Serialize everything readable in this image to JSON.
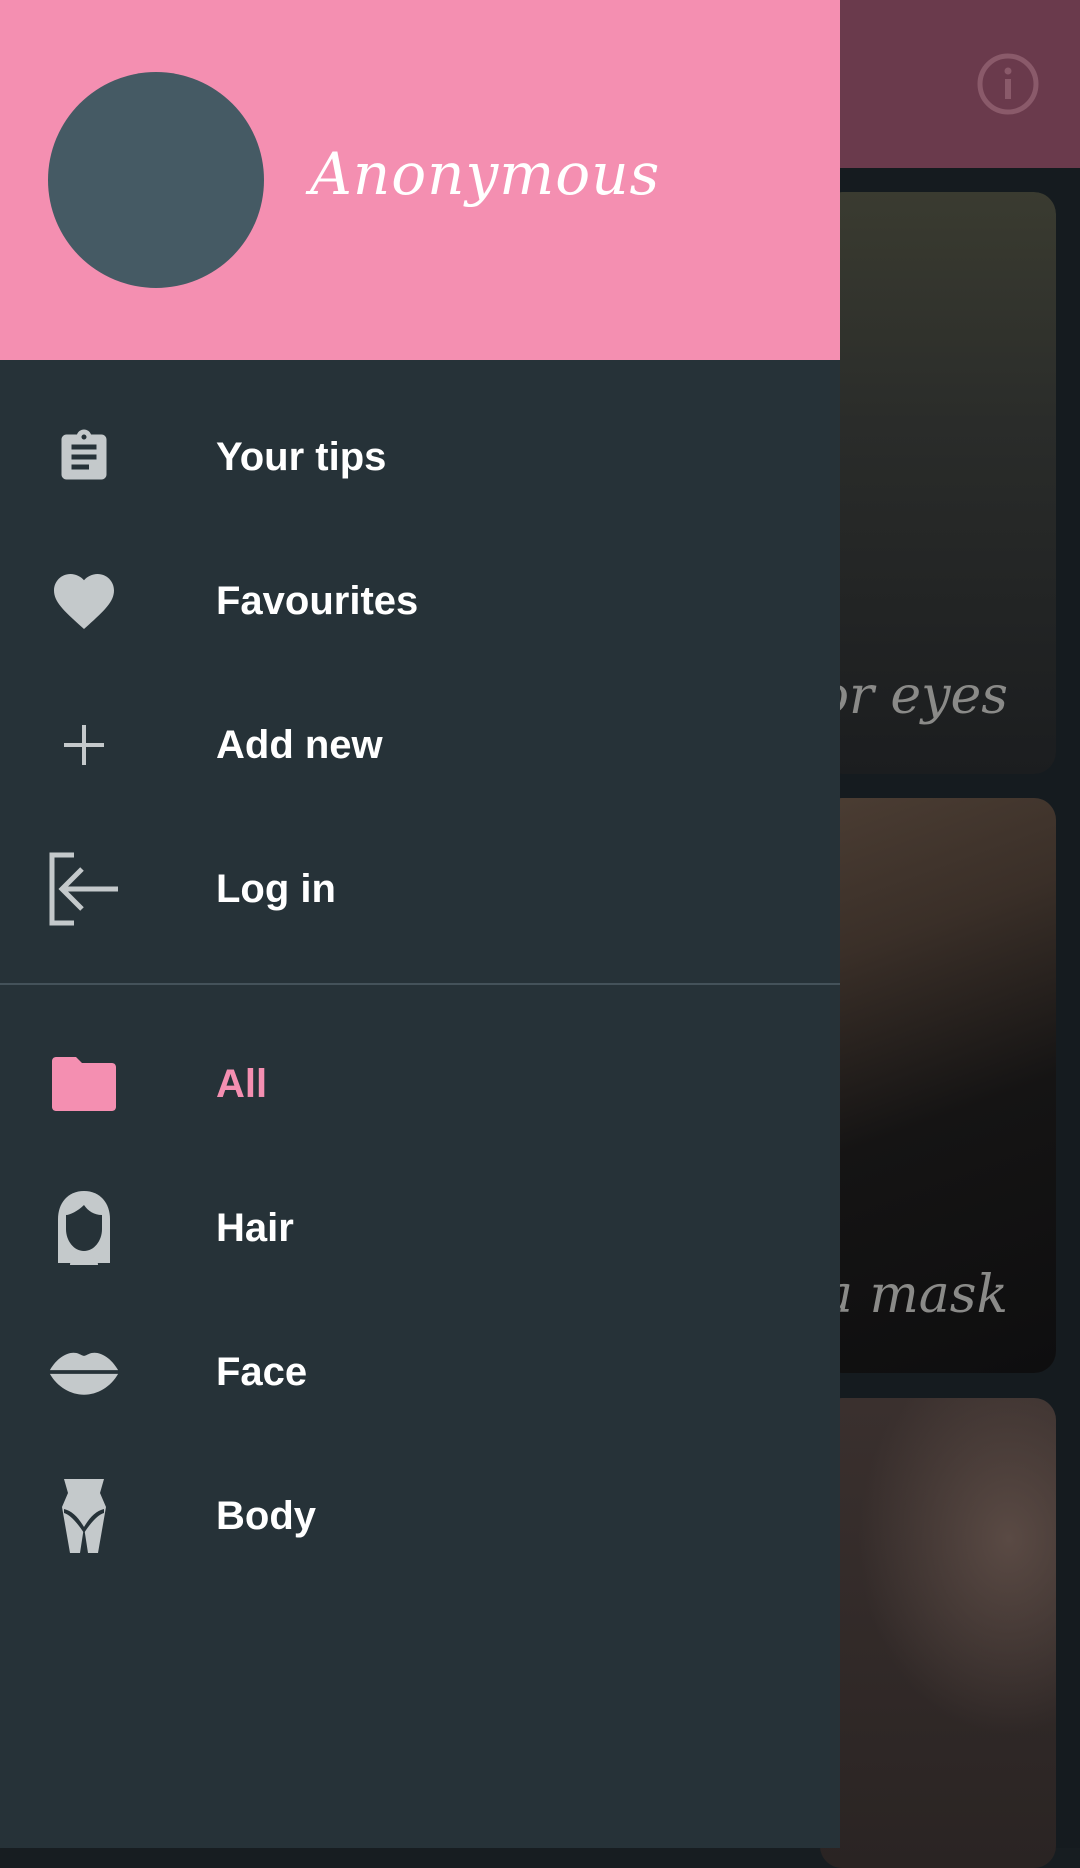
{
  "background": {
    "appbar_icon": "info-icon",
    "cards": [
      {
        "caption": "or eyes"
      },
      {
        "caption": "a mask"
      },
      {
        "caption": ""
      }
    ]
  },
  "drawer": {
    "username": "Anonymous",
    "account_items": [
      {
        "icon": "clipboard-icon",
        "label": "Your tips"
      },
      {
        "icon": "heart-icon",
        "label": "Favourites"
      },
      {
        "icon": "plus-icon",
        "label": "Add new"
      },
      {
        "icon": "login-icon",
        "label": "Log in"
      }
    ],
    "category_items": [
      {
        "icon": "folder-icon",
        "label": "All",
        "active": true
      },
      {
        "icon": "hair-icon",
        "label": "Hair"
      },
      {
        "icon": "lips-icon",
        "label": "Face"
      },
      {
        "icon": "body-icon",
        "label": "Body"
      }
    ]
  },
  "colors": {
    "header": "#f48fb1",
    "drawer_bg": "#263238",
    "avatar": "#455a64",
    "active_text": "#f48fb1",
    "icon": "#c4c9cb"
  }
}
